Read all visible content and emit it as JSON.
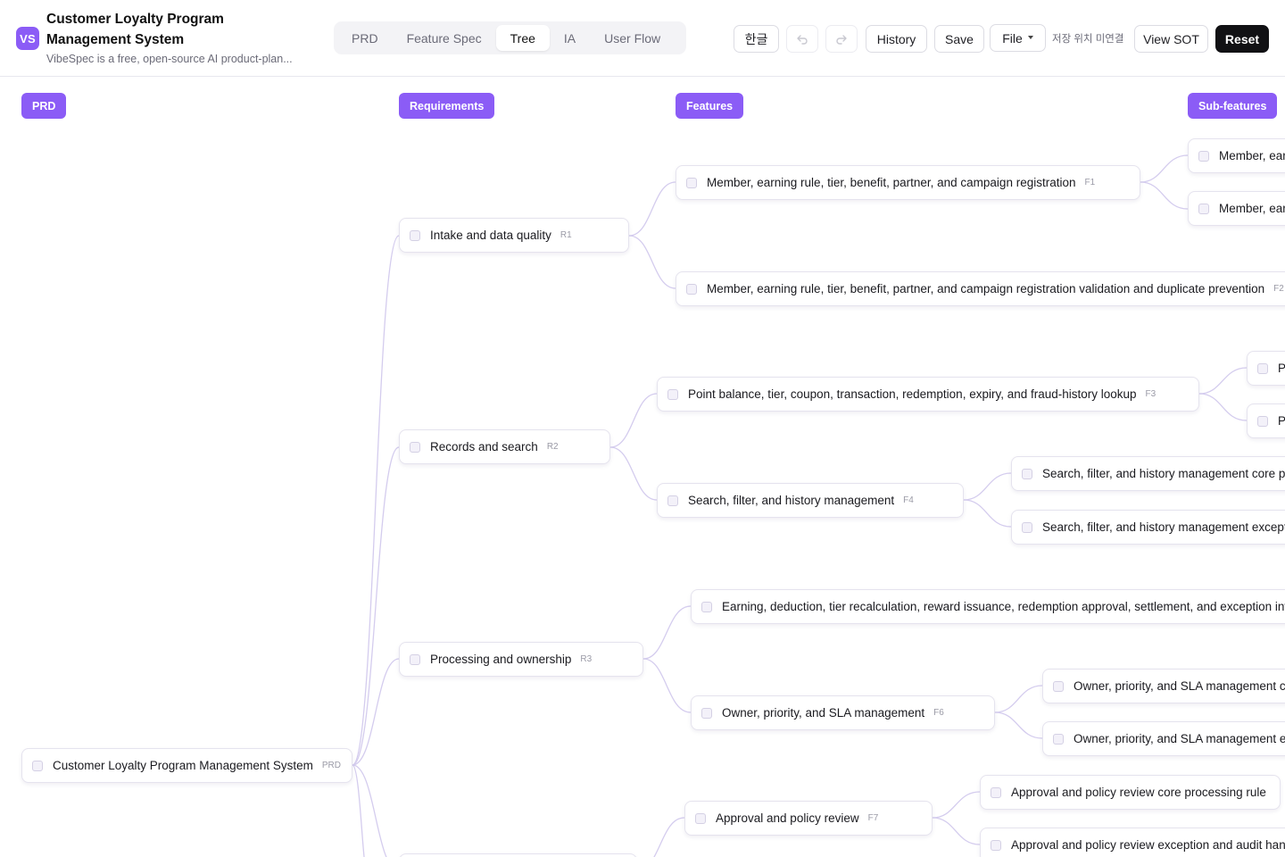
{
  "app": {
    "logo_text": "VS",
    "title": "Customer Loyalty Program Management System",
    "subtitle": "VibeSpec is a free, open-source AI product-plan..."
  },
  "tabs": [
    {
      "label": "PRD",
      "active": false
    },
    {
      "label": "Feature Spec",
      "active": false
    },
    {
      "label": "Tree",
      "active": true
    },
    {
      "label": "IA",
      "active": false
    },
    {
      "label": "User Flow",
      "active": false
    }
  ],
  "toolbar": {
    "language_label": "한글",
    "undo_icon": "undo-icon",
    "redo_icon": "redo-icon",
    "history_label": "History",
    "save_label": "Save",
    "file_label": "File",
    "save_location_status": "저장 위치 미연결",
    "view_sot_label": "View SOT",
    "reset_label": "Reset"
  },
  "columns": {
    "prd": "PRD",
    "requirements": "Requirements",
    "features": "Features",
    "subfeatures": "Sub-features"
  },
  "colors": {
    "accent": "#8b5cf6",
    "edge": "#d4ccee",
    "reset_bg": "#111114"
  },
  "tree": {
    "root": {
      "label": "Customer Loyalty Program Management System",
      "id": "PRD"
    },
    "requirements": [
      {
        "label": "Intake and data quality",
        "id": "R1"
      },
      {
        "label": "Records and search",
        "id": "R2"
      },
      {
        "label": "Processing and ownership",
        "id": "R3"
      }
    ],
    "features": [
      {
        "label": "Member, earning rule, tier, benefit, partner, and campaign registration",
        "id": "F1"
      },
      {
        "label": "Member, earning rule, tier, benefit, partner, and campaign registration validation and duplicate prevention",
        "id": "F2"
      },
      {
        "label": "Point balance, tier, coupon, transaction, redemption, expiry, and fraud-history lookup",
        "id": "F3"
      },
      {
        "label": "Search, filter, and history management",
        "id": "F4"
      },
      {
        "label": "Earning, deduction, tier recalculation, reward issuance, redemption approval, settlement, and exception investigation",
        "id": "F5"
      },
      {
        "label": "Owner, priority, and SLA management",
        "id": "F6"
      },
      {
        "label": "Approval and policy review",
        "id": "F7"
      }
    ],
    "subfeatures": [
      {
        "label": "Member, earning rule, tier, benefit, partner, and campaign registration core processing rule"
      },
      {
        "label": "Member, earning rule, tier, benefit, partner, and campaign registration exception and audit handling"
      },
      {
        "label": "Point balance, tier, coupon, transaction, redemption, expiry, and fraud-history lookup core processing rule"
      },
      {
        "label": "Point balance, tier, coupon, transaction, redemption, expiry, and fraud-history lookup exception and audit handling"
      },
      {
        "label": "Search, filter, and history management core processing rule"
      },
      {
        "label": "Search, filter, and history management exception and audit handling"
      },
      {
        "label": "Owner, priority, and SLA management core processing rule"
      },
      {
        "label": "Owner, priority, and SLA management exception and audit handling"
      },
      {
        "label": "Approval and policy review core processing rule"
      },
      {
        "label": "Approval and policy review exception and audit handling"
      }
    ]
  }
}
